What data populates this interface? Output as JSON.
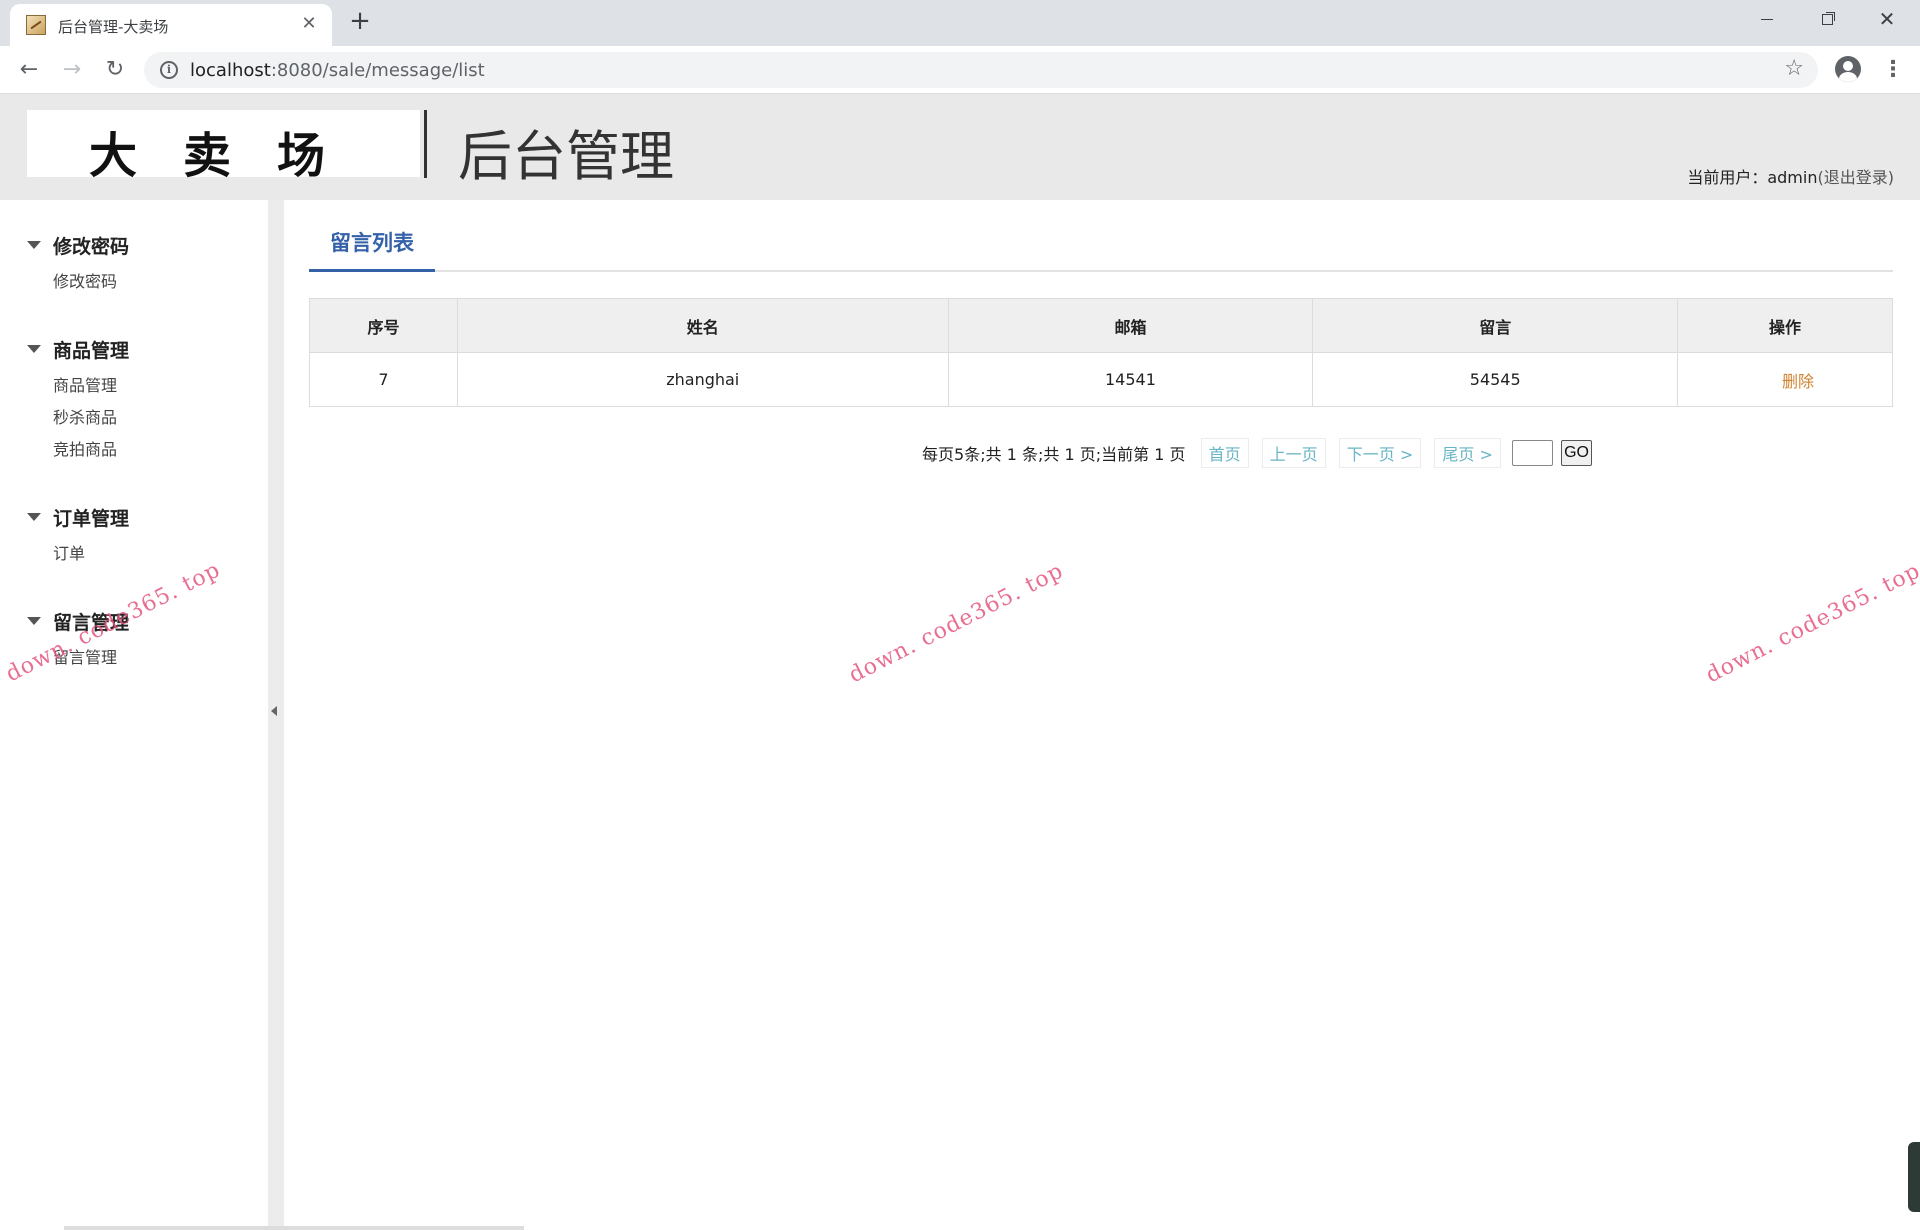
{
  "browser": {
    "tab_title": "后台管理-大卖场",
    "tab_close": "✕",
    "new_tab": "+",
    "url_host": "localhost",
    "url_rest": ":8080/sale/message/list",
    "icons": {
      "back": "back-arrow-icon",
      "forward": "forward-arrow-icon",
      "reload": "reload-icon",
      "info": "info-icon",
      "star": "star-icon",
      "account": "account-icon",
      "menu": "menu-icon"
    }
  },
  "header": {
    "logo": "大卖场",
    "title": "后台管理",
    "user_prefix": "当前用户：",
    "username": "admin",
    "logout_open": "(",
    "logout": "退出登录",
    "logout_close": ")"
  },
  "sidebar": {
    "groups": [
      {
        "title": "修改密码",
        "items": [
          "修改密码"
        ]
      },
      {
        "title": "商品管理",
        "items": [
          "商品管理",
          "秒杀商品",
          "竞拍商品"
        ]
      },
      {
        "title": "订单管理",
        "items": [
          "订单"
        ]
      },
      {
        "title": "留言管理",
        "items": [
          "留言管理"
        ]
      }
    ]
  },
  "main": {
    "tab": "留言列表",
    "table": {
      "headers": [
        "序号",
        "姓名",
        "邮箱",
        "留言",
        "操作"
      ],
      "rows": [
        {
          "id": "7",
          "name": "zhanghai",
          "email": "14541",
          "message": "54545",
          "action": "删除"
        }
      ]
    },
    "pager": {
      "summary": "每页5条;共 1 条;共 1 页;当前第 1 页",
      "first": "首页",
      "prev": "上一页",
      "next": "下一页 >",
      "last": "尾页 >",
      "go": "GO",
      "page_input": ""
    }
  },
  "watermark": "down. code365. top",
  "colors": {
    "accent": "#3461a8",
    "delete": "#d2822e",
    "pager_link": "#69b4c6",
    "watermark": "#e5577f"
  }
}
